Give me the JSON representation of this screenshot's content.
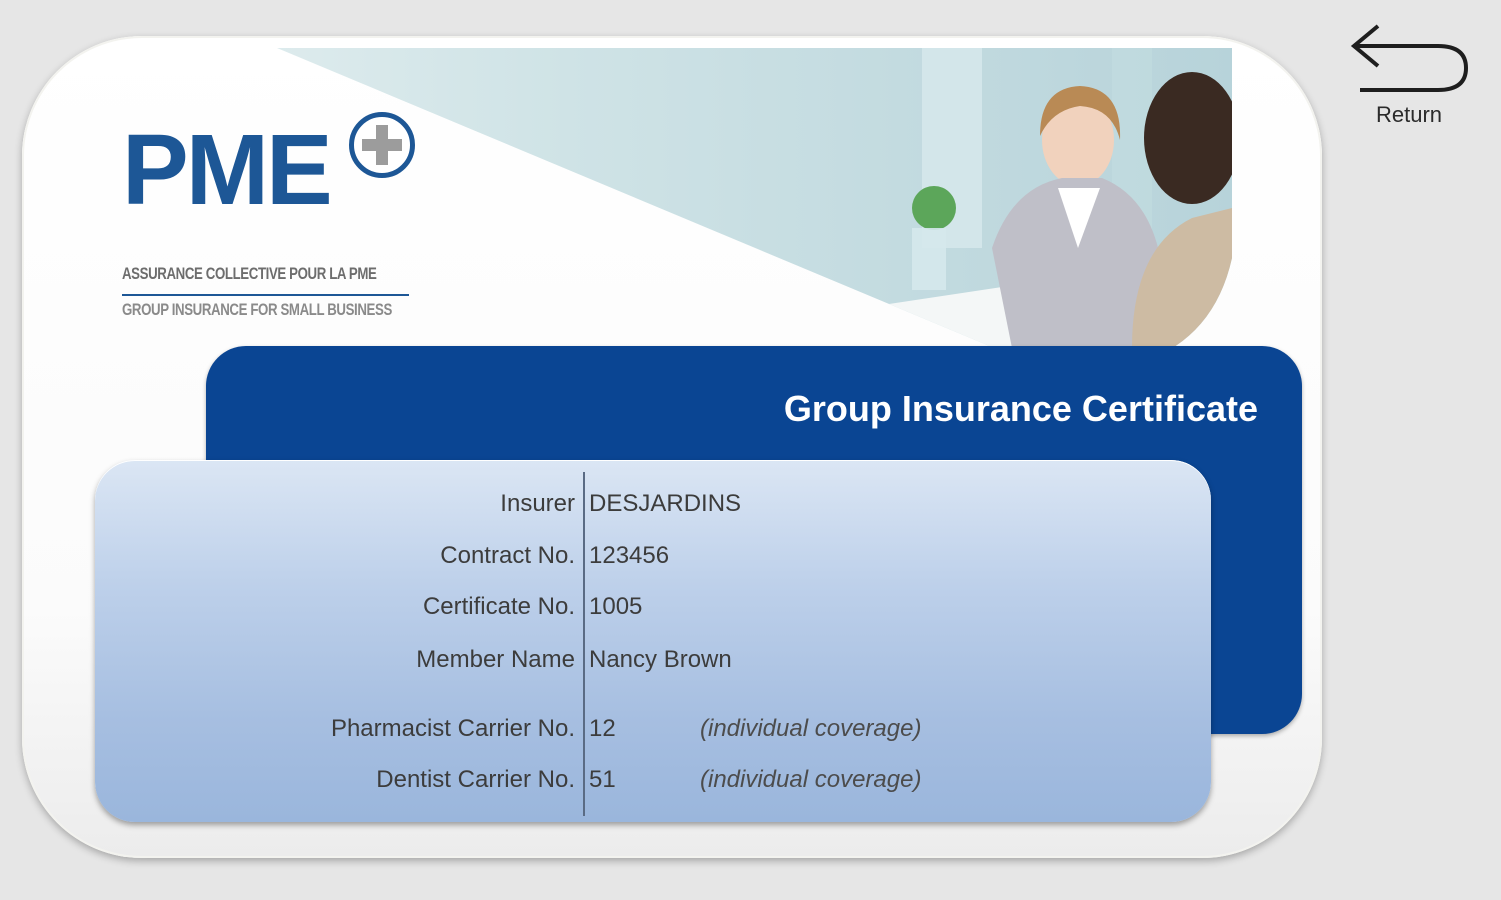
{
  "logo": {
    "word": "PME",
    "tagline_fr": "ASSURANCE COLLECTIVE POUR LA PME",
    "tagline_en": "GROUP INSURANCE FOR SMALL BUSINESS"
  },
  "certificate": {
    "title": "Group Insurance Certificate",
    "rows": [
      {
        "label": "Insurer",
        "value": "DESJARDINS",
        "note": ""
      },
      {
        "label": "Contract No.",
        "value": "123456",
        "note": ""
      },
      {
        "label": "Certificate No.",
        "value": "1005",
        "note": ""
      },
      {
        "label": "Member Name",
        "value": "Nancy Brown",
        "note": ""
      },
      {
        "label": "Pharmacist Carrier No.",
        "value": "12",
        "note": "(individual coverage)"
      },
      {
        "label": "Dentist Carrier No.",
        "value": "51",
        "note": "(individual coverage)"
      }
    ]
  },
  "nav": {
    "return_label": "Return",
    "return_icon": "return-arrow-icon"
  },
  "colors": {
    "brand_blue": "#0a4593",
    "logo_blue": "#1d5796",
    "background": "#e6e6e6"
  }
}
